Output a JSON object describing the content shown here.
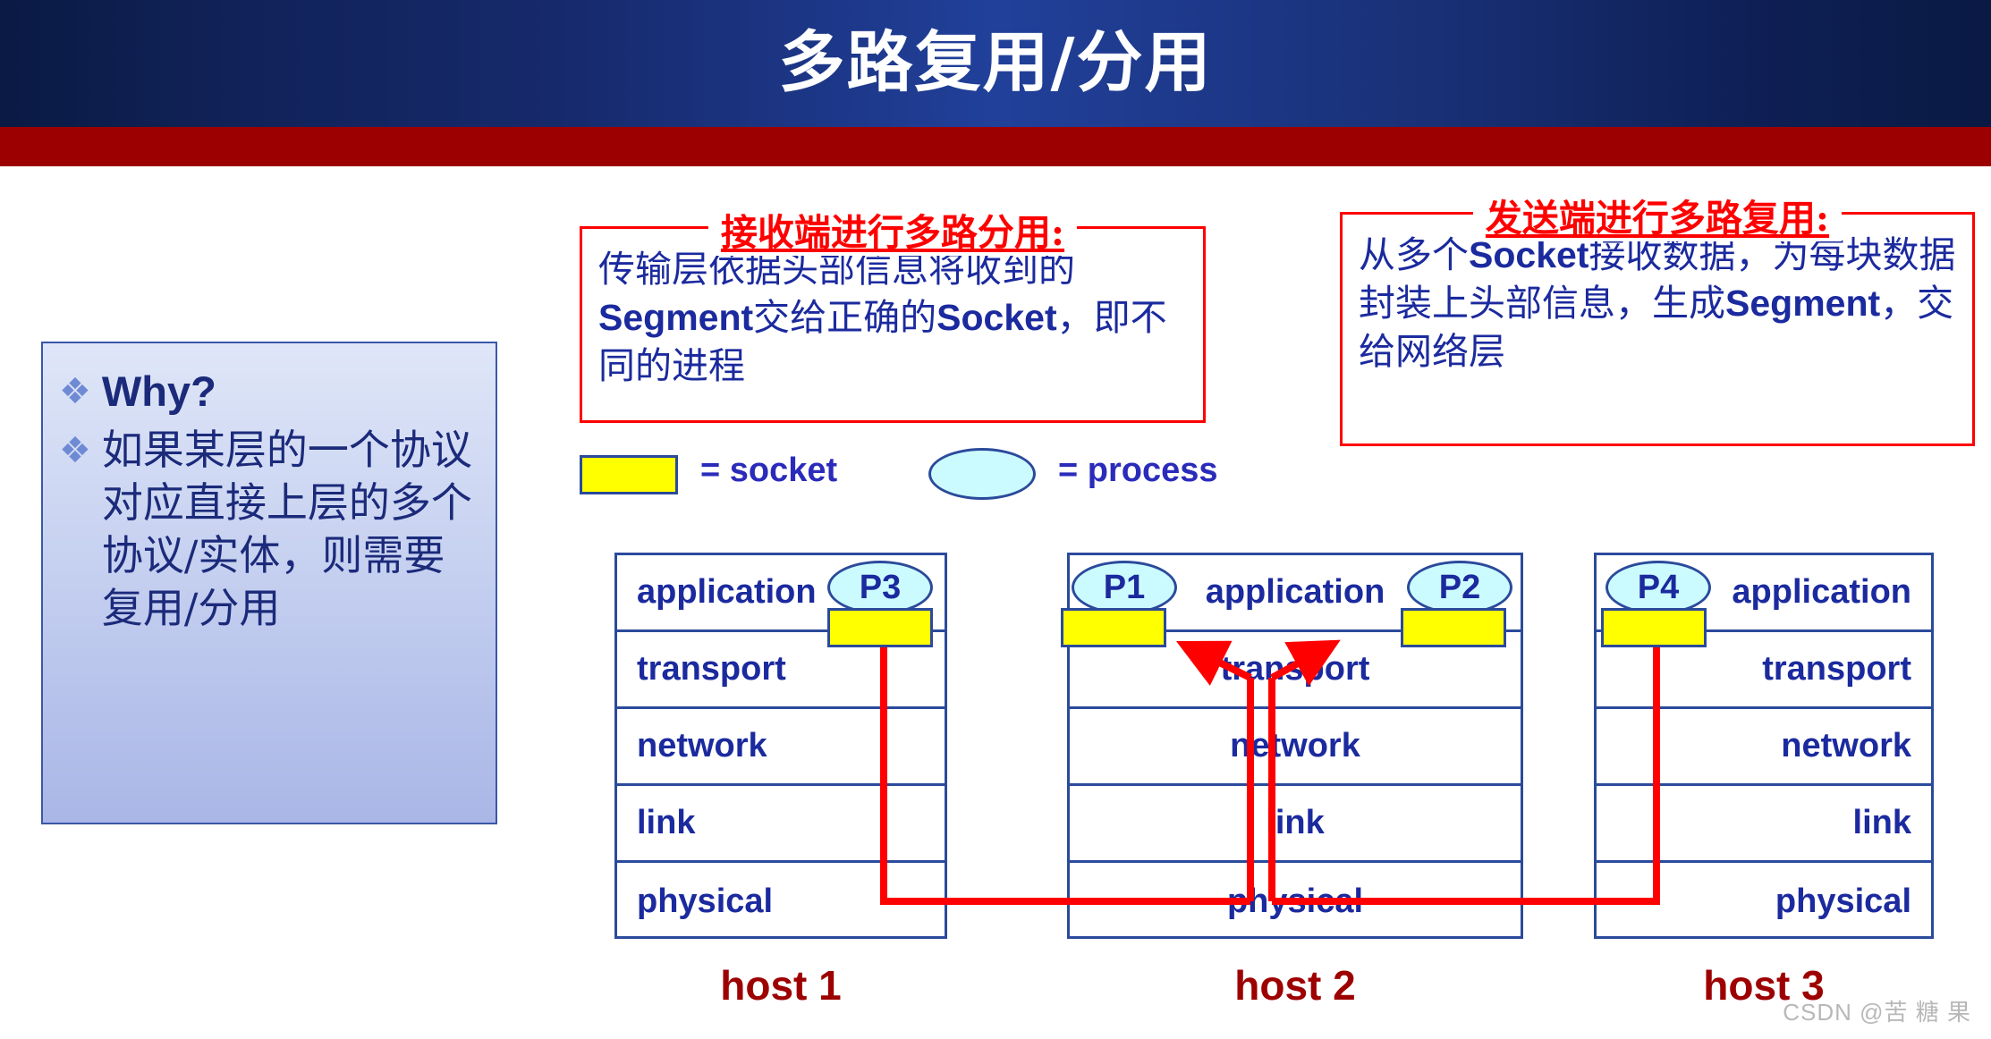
{
  "header": {
    "title": "多路复用/分用",
    "band_color": "#21409a",
    "rule_color": "#9d0000"
  },
  "why_box": {
    "bullet_glyph": "❖",
    "items": [
      {
        "text": "Why?",
        "style": "bold-en"
      },
      {
        "text": "如果某层的一个协议对应直接上层的多个协议/实体，则需要复用/分用",
        "style": "cn"
      }
    ]
  },
  "callouts": [
    {
      "id": "demux",
      "title": "接收端进行多路分用:",
      "title_color": "#ff0000",
      "border_color": "#ff0000",
      "body_html": "传输层依据头部信息将收到的<b>Segment</b>交给正确的<b>Socket</b>，即不同的进程",
      "body_color": "#1b2a9e"
    },
    {
      "id": "mux",
      "title": "发送端进行多路复用:",
      "title_color": "#ff0000",
      "border_color": "#ff0000",
      "body_html": "从多个<b>Socket</b>接收数据，为每块数据封装上头部信息，生成<b>Segment</b>，交给网络层",
      "body_color": "#1b2a9e"
    }
  ],
  "legend": {
    "socket": {
      "label": "= socket",
      "swatch_color": "#ffff00",
      "border_color": "#2b4a9b"
    },
    "process": {
      "label": "= process",
      "swatch_color": "#ccfbff",
      "border_color": "#2b4a9b"
    }
  },
  "hosts": [
    {
      "caption": "host 1",
      "align": "left",
      "layers": [
        "application",
        "transport",
        "network",
        "link",
        "physical"
      ],
      "processes": [
        {
          "label": "P3",
          "side": "right"
        }
      ],
      "sockets": 1
    },
    {
      "caption": "host 2",
      "align": "center",
      "layers": [
        "application",
        "transport",
        "network",
        "link",
        "physical"
      ],
      "processes": [
        {
          "label": "P1",
          "side": "left"
        },
        {
          "label": "P2",
          "side": "right"
        }
      ],
      "sockets": 2
    },
    {
      "caption": "host 3",
      "align": "right",
      "layers": [
        "application",
        "transport",
        "network",
        "link",
        "physical"
      ],
      "processes": [
        {
          "label": "P4",
          "side": "left"
        }
      ],
      "sockets": 1
    }
  ],
  "wire_color": "#ff0000",
  "watermark": "CSDN @苦 糖 果"
}
